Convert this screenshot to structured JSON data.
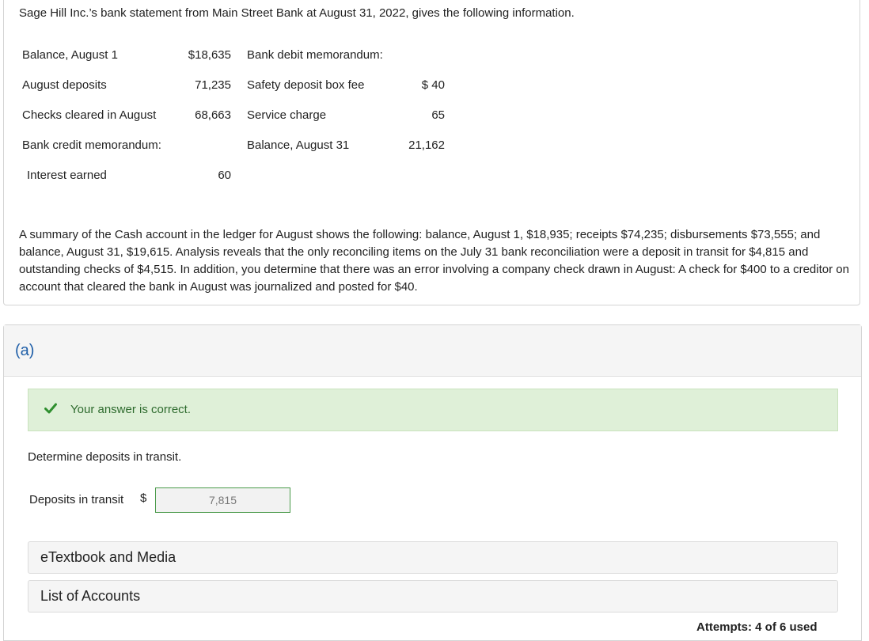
{
  "problem": {
    "intro": "Sage Hill Inc.’s bank statement from Main Street Bank at August 31, 2022, gives the following information.",
    "left_rows": [
      {
        "label": "Balance, August 1",
        "value": "$18,635"
      },
      {
        "label": "August deposits",
        "value": "71,235"
      },
      {
        "label": "Checks cleared in August",
        "value": "68,663"
      },
      {
        "label": "Bank credit memorandum:",
        "value": ""
      },
      {
        "label": "Interest earned",
        "value": "60"
      }
    ],
    "right_rows": [
      {
        "label": "Bank debit memorandum:",
        "value": ""
      },
      {
        "label": "Safety deposit box fee",
        "value": "$ 40"
      },
      {
        "label": "Service charge",
        "value": "65"
      },
      {
        "label": "Balance, August 31",
        "value": "21,162"
      }
    ],
    "summary": "A summary of the Cash account in the ledger for August shows the following: balance, August 1, $18,935; receipts $74,235; disbursements $73,555; and balance, August 31, $19,615. Analysis reveals that the only reconciling items on the July 31 bank reconciliation were a deposit in transit for $4,815 and outstanding checks of $4,515. In addition, you determine that there was an error involving a company check drawn in August: A check for $400 to a creditor on account that cleared the bank in August was journalized and posted for $40."
  },
  "part": {
    "label": "(a)",
    "feedback": "Your answer is correct.",
    "question": "Determine deposits in transit.",
    "field_label": "Deposits in transit",
    "currency": "$",
    "answer_value": "7,815",
    "links": [
      "eTextbook and Media",
      "List of Accounts"
    ],
    "attempts": "Attempts: 4 of 6 used"
  },
  "colors": {
    "accent": "#1f5fa8",
    "success_bg": "#dff0d8",
    "success_text": "#2e6b2e",
    "check": "#2f8f2f"
  }
}
